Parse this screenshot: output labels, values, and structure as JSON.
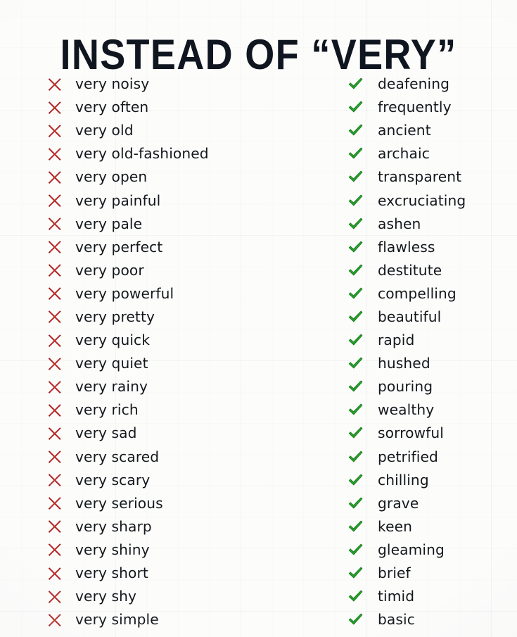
{
  "page": {
    "title": "INSTEAD OF “VERY”",
    "background_color": "#fcfcfb",
    "title_color": "#101620"
  },
  "legend": {
    "bad_icon": "red-cross-icon",
    "good_icon": "green-check-icon",
    "bad_color": "#9e1b1b",
    "bad_color_light": "#c4352f",
    "good_color": "#2aa32a",
    "good_color_dark": "#13781a"
  },
  "rows": [
    {
      "bad": "very noisy",
      "good": "deafening"
    },
    {
      "bad": "very often",
      "good": "frequently"
    },
    {
      "bad": "very old",
      "good": "ancient"
    },
    {
      "bad": "very old-fashioned",
      "good": "archaic"
    },
    {
      "bad": "very open",
      "good": "transparent"
    },
    {
      "bad": "very painful",
      "good": "excruciating"
    },
    {
      "bad": "very pale",
      "good": "ashen"
    },
    {
      "bad": "very perfect",
      "good": "flawless"
    },
    {
      "bad": "very poor",
      "good": "destitute"
    },
    {
      "bad": "very powerful",
      "good": "compelling"
    },
    {
      "bad": "very pretty",
      "good": "beautiful"
    },
    {
      "bad": "very quick",
      "good": "rapid"
    },
    {
      "bad": "very quiet",
      "good": "hushed"
    },
    {
      "bad": "very rainy",
      "good": "pouring"
    },
    {
      "bad": "very rich",
      "good": "wealthy"
    },
    {
      "bad": "very sad",
      "good": "sorrowful"
    },
    {
      "bad": "very scared",
      "good": "petrified"
    },
    {
      "bad": "very scary",
      "good": "chilling"
    },
    {
      "bad": "very serious",
      "good": "grave"
    },
    {
      "bad": "very sharp",
      "good": "keen"
    },
    {
      "bad": "very shiny",
      "good": "gleaming"
    },
    {
      "bad": "very short",
      "good": "brief"
    },
    {
      "bad": "very shy",
      "good": "timid"
    },
    {
      "bad": "very simple",
      "good": "basic"
    }
  ]
}
